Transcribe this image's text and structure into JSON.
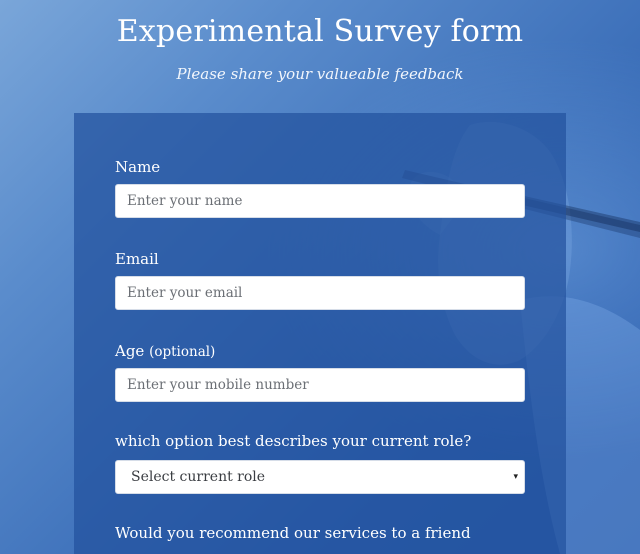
{
  "header": {
    "title": "Experimental Survey form",
    "subtitle": "Please share your valueable feedback"
  },
  "form": {
    "name": {
      "label": "Name",
      "placeholder": "Enter your name"
    },
    "email": {
      "label": "Email",
      "placeholder": "Enter your email"
    },
    "age": {
      "label": "Age",
      "label_note": "(optional)",
      "placeholder": "Enter your mobile number"
    },
    "role": {
      "label": "which option best describes your current role?",
      "selected": "Select current role",
      "caret_icon": "▾"
    },
    "recommend": {
      "label": "Would you recommend our services to a friend"
    }
  }
}
